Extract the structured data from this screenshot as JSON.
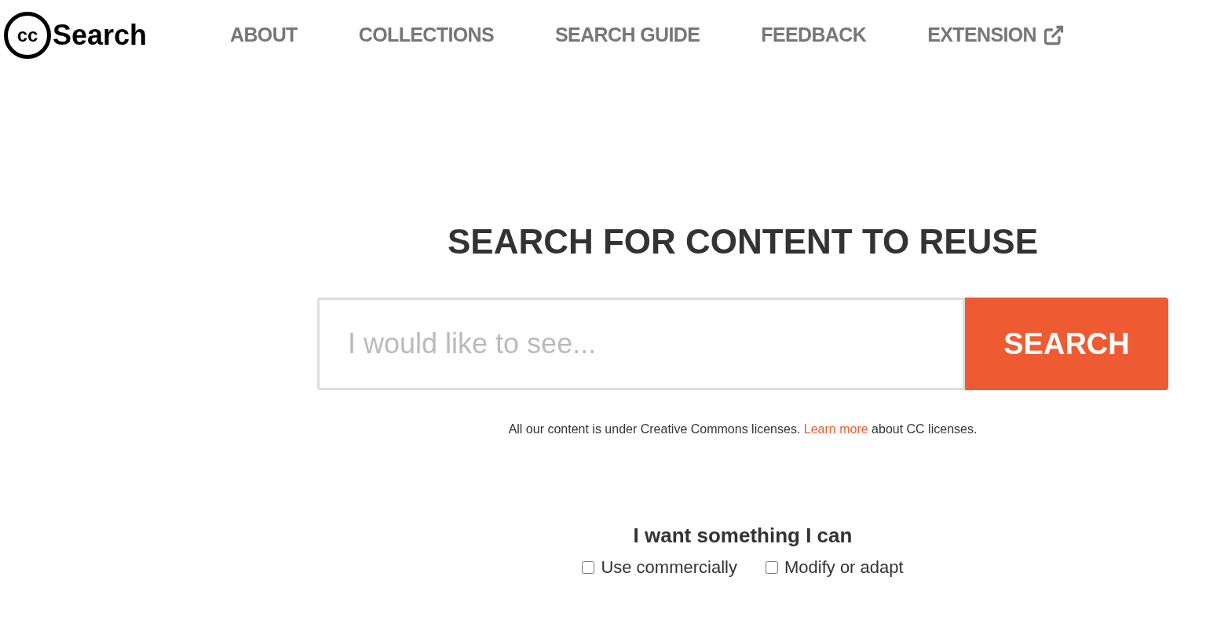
{
  "logo": {
    "mark": "cc",
    "name": "Search"
  },
  "nav": [
    {
      "label": "ABOUT",
      "external": false
    },
    {
      "label": "COLLECTIONS",
      "external": false
    },
    {
      "label": "SEARCH GUIDE",
      "external": false
    },
    {
      "label": "FEEDBACK",
      "external": false
    },
    {
      "label": "EXTENSION",
      "external": true
    }
  ],
  "hero": {
    "title": "SEARCH FOR CONTENT TO REUSE",
    "search": {
      "placeholder": "I would like to see...",
      "button": "SEARCH"
    },
    "note": {
      "before": "All our content is under Creative Commons licenses.",
      "link": "Learn more",
      "after": "about CC licenses."
    }
  },
  "filters": {
    "heading": "I want something I can",
    "options": [
      {
        "label": "Use commercially",
        "checked": false
      },
      {
        "label": "Modify or adapt",
        "checked": false
      }
    ]
  }
}
